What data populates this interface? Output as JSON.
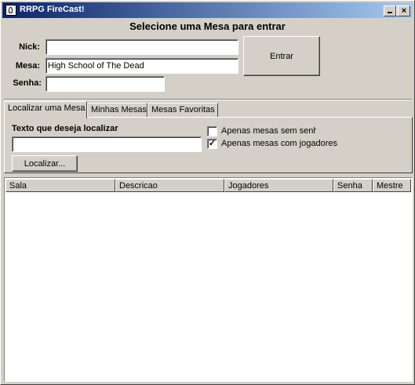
{
  "window": {
    "title": "RRPG FireCast!",
    "icon": "rrpg-app-icon"
  },
  "header": {
    "title": "Selecione uma Mesa para entrar"
  },
  "form": {
    "nick_label": "Nick:",
    "nick_value": "",
    "mesa_label": "Mesa:",
    "mesa_value": "High School of The Dead",
    "senha_label": "Senha:",
    "senha_value": "",
    "enter_button": "Entrar"
  },
  "tabs": [
    {
      "label": "Localizar uma Mesa",
      "active": true
    },
    {
      "label": "Minhas Mesas",
      "active": false
    },
    {
      "label": "Mesas Favoritas",
      "active": false
    }
  ],
  "search": {
    "label": "Texto que deseja localizar",
    "value": "",
    "button": "Localizar...",
    "options": [
      {
        "label": "Apenas mesas sem senha",
        "checked": false
      },
      {
        "label": "Apenas mesas com jogadores",
        "checked": true
      }
    ]
  },
  "table": {
    "columns": [
      "Sala",
      "Descricao",
      "Jogadores",
      "Senha",
      "Mestre"
    ],
    "rows": []
  }
}
